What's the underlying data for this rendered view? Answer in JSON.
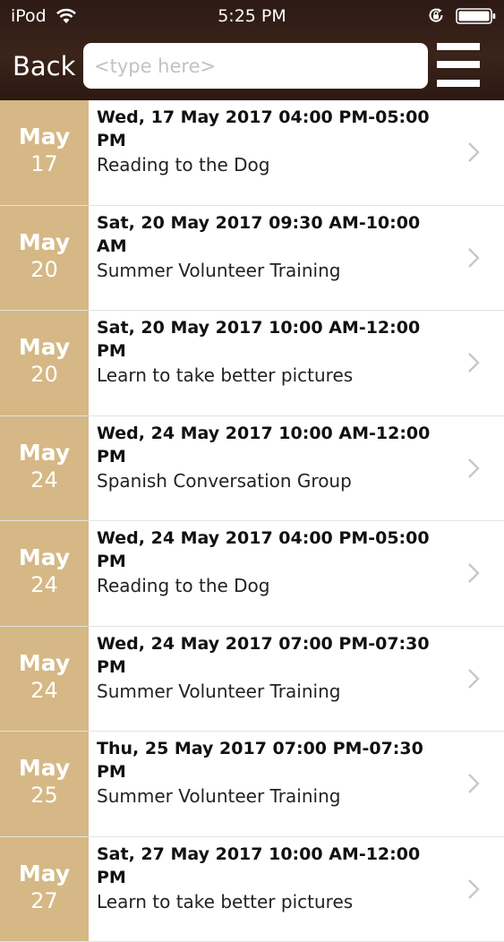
{
  "status_bar": {
    "carrier": "iPod",
    "time": "5:25 PM"
  },
  "header": {
    "back_label": "Back",
    "search": {
      "placeholder": "<type here>",
      "value": ""
    }
  },
  "icons": {
    "wifi": "wifi-icon",
    "rotation_lock": "lock-icon",
    "battery": "battery-icon",
    "menu": "hamburger-menu-icon",
    "row_disclosure": "chevron-right-icon"
  },
  "colors": {
    "header_background": "#341f17",
    "date_cell_background": "#d5b885",
    "date_cell_text": "#ffffff",
    "chevron": "#c7c7cc"
  },
  "events": [
    {
      "month": "May",
      "day": "17",
      "when": "Wed, 17 May 2017 04:00 PM-05:00 PM",
      "title": "Reading to the Dog"
    },
    {
      "month": "May",
      "day": "20",
      "when": "Sat, 20 May 2017 09:30 AM-10:00 AM",
      "title": "Summer Volunteer Training"
    },
    {
      "month": "May",
      "day": "20",
      "when": "Sat, 20 May 2017 10:00 AM-12:00 PM",
      "title": "Learn to take better pictures"
    },
    {
      "month": "May",
      "day": "24",
      "when": "Wed, 24 May 2017 10:00 AM-12:00 PM",
      "title": "Spanish Conversation Group"
    },
    {
      "month": "May",
      "day": "24",
      "when": "Wed, 24 May 2017 04:00 PM-05:00 PM",
      "title": "Reading to the Dog"
    },
    {
      "month": "May",
      "day": "24",
      "when": "Wed, 24 May 2017 07:00 PM-07:30 PM",
      "title": "Summer Volunteer Training"
    },
    {
      "month": "May",
      "day": "25",
      "when": "Thu, 25 May 2017 07:00 PM-07:30 PM",
      "title": "Summer Volunteer Training"
    },
    {
      "month": "May",
      "day": "27",
      "when": "Sat, 27 May 2017 10:00 AM-12:00 PM",
      "title": "Learn to take better pictures"
    }
  ]
}
